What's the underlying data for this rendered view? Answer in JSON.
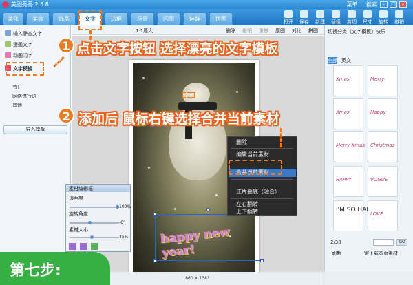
{
  "app": {
    "title": "美图秀秀 2.5.8",
    "links": [
      "菜单",
      "搜索"
    ]
  },
  "tabs": [
    "美化",
    "美容",
    "饰品",
    "文字",
    "边框",
    "场景",
    "闪图",
    "娃娃",
    "拼图"
  ],
  "toolbar": [
    "打开",
    "保存",
    "新建",
    "替换",
    "剪切",
    "尺寸",
    "旋转",
    "撤销"
  ],
  "left": {
    "items": [
      "输入静态文字",
      "漫画文字",
      "动画闪字",
      "文字模板"
    ],
    "sub_items": [
      "节日",
      "网络流行语",
      "其他"
    ],
    "import_label": "导入模板"
  },
  "canvas_toolbar": {
    "zoom_label": "1:1原大",
    "actions": [
      "删除",
      "撤销",
      "重做",
      "原图",
      "对比",
      "拼图"
    ]
  },
  "context_menu": {
    "items": [
      "删除",
      "编辑当前素材",
      "合并当前素材",
      "正片叠底（融合）",
      "左右翻转",
      "上下翻转"
    ],
    "selected": "合并当前素材"
  },
  "editor": {
    "title": "素材编辑框",
    "rows": [
      {
        "label": "透明度",
        "value": "100%",
        "level": 1.0
      },
      {
        "label": "旋转角度",
        "value": "-6°",
        "level": 0.4
      },
      {
        "label": "素材大小",
        "value": "45%",
        "level": 0.45
      }
    ]
  },
  "sticker": {
    "text": "happy new year!"
  },
  "right": {
    "header": "切换分类《文字模板》快乐",
    "filters": [
      "全部",
      "英文"
    ],
    "thumbs": [
      "Xmas",
      "Merry",
      "Xmas",
      "Happy",
      "Merry Xmas",
      "Christmas",
      "HAPPY",
      "VOGUE",
      "I'M SO HAPPY",
      "LOVE"
    ],
    "pager": "2/38",
    "go": "GO",
    "refresh": "刷新",
    "download": "一键下载本页素材"
  },
  "annotations": {
    "step1_num": "1",
    "step1": "点击文字按钮 选择漂亮的文字模板",
    "step2_num": "2",
    "step2": "添加后 鼠标右键选择合并当前素材",
    "step_label": "第七步:"
  },
  "status": {
    "size": "860 × 1381"
  }
}
